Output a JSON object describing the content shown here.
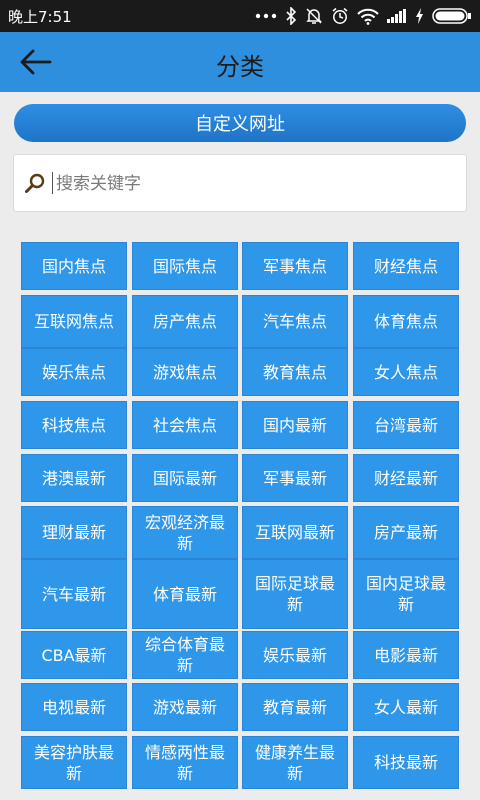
{
  "status_bar": {
    "time": "晚上7:51",
    "icons": [
      "more-dots-icon",
      "bluetooth-icon",
      "mute-icon",
      "alarm-icon",
      "wifi-icon",
      "signal-icon",
      "charging-icon",
      "battery-icon"
    ]
  },
  "header": {
    "title": "分类",
    "back_icon": "back-arrow-icon"
  },
  "custom_url_label": "自定义网址",
  "search": {
    "placeholder": "搜索关键字",
    "value": "",
    "icon": "search-icon"
  },
  "colors": {
    "accent": "#2f8fdf",
    "tile": "#2f97ea",
    "status_bar": "#1a1a1a",
    "background": "#ececec"
  },
  "categories": [
    "国内焦点",
    "国际焦点",
    "军事焦点",
    "财经焦点",
    "互联网焦点",
    "房产焦点",
    "汽车焦点",
    "体育焦点",
    "娱乐焦点",
    "游戏焦点",
    "教育焦点",
    "女人焦点",
    "科技焦点",
    "社会焦点",
    "国内最新",
    "台湾最新",
    "港澳最新",
    "国际最新",
    "军事最新",
    "财经最新",
    "理财最新",
    "宏观经济最新",
    "互联网最新",
    "房产最新",
    "汽车最新",
    "体育最新",
    "国际足球最新",
    "国内足球最新",
    "CBA最新",
    "综合体育最新",
    "娱乐最新",
    "电影最新",
    "电视最新",
    "游戏最新",
    "教育最新",
    "女人最新",
    "美容护肤最新",
    "情感两性最新",
    "健康养生最新",
    "科技最新"
  ]
}
